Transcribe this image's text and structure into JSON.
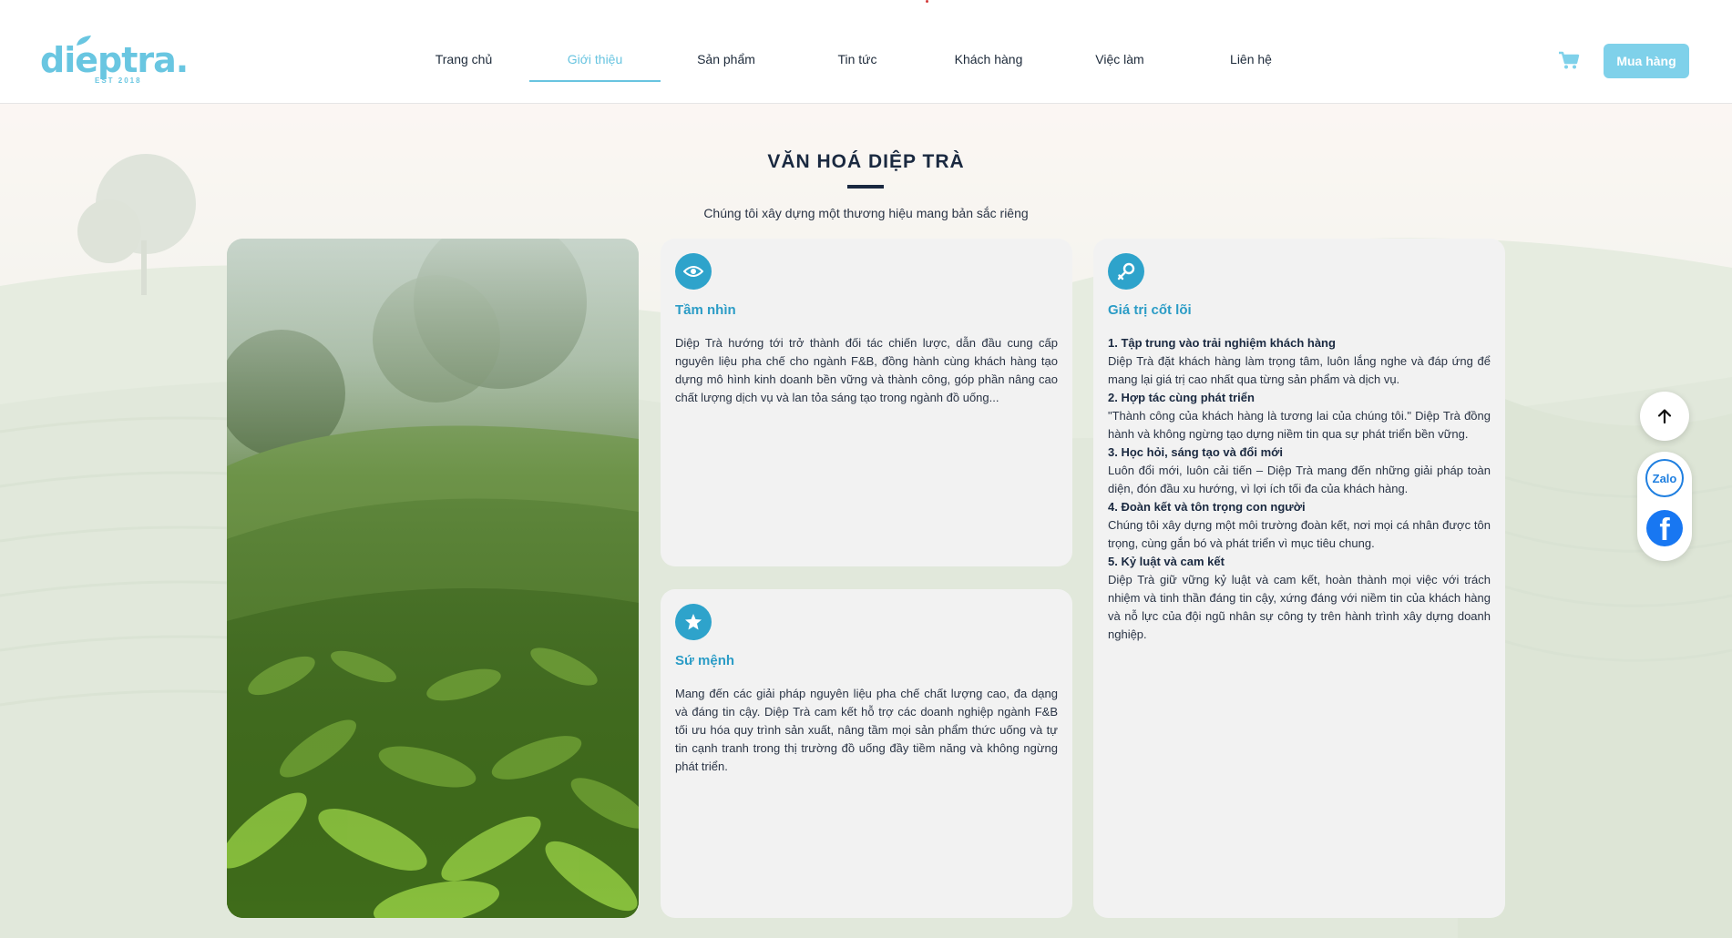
{
  "brand": {
    "logo_text": "dieptra.",
    "logo_sub": "EST 2018"
  },
  "nav": {
    "items": [
      {
        "label": "Trang chủ",
        "active": false
      },
      {
        "label": "Giới thiệu",
        "active": true
      },
      {
        "label": "Sản phẩm",
        "active": false
      },
      {
        "label": "Tin tức",
        "active": false
      },
      {
        "label": "Khách hàng",
        "active": false
      },
      {
        "label": "Việc làm",
        "active": false
      },
      {
        "label": "Liên hệ",
        "active": false
      }
    ],
    "buy_label": "Mua hàng",
    "accent_color": "#68c4e0"
  },
  "section": {
    "title": "VĂN HOÁ DIỆP TRÀ",
    "subtitle": "Chúng tôi xây dựng một thương hiệu mang bản sắc riêng"
  },
  "vision": {
    "icon": "eye-icon",
    "title": "Tầm nhìn",
    "text": "Diệp Trà hướng tới trở thành đối tác chiến lược, dẫn đầu cung cấp nguyên liệu pha chế cho ngành F&B, đồng hành cùng khách hàng tạo dựng mô hình kinh doanh bền vững và thành công, góp phần nâng cao chất lượng dịch vụ và lan tỏa sáng tạo trong ngành đồ uống..."
  },
  "mission": {
    "icon": "star-icon",
    "title": "Sứ mệnh",
    "text": "Mang đến các giải pháp nguyên liệu pha chế chất lượng cao, đa dạng và đáng tin cậy. Diệp Trà cam kết hỗ trợ các doanh nghiệp ngành F&B tối ưu hóa quy trình sản xuất, nâng tầm mọi sản phẩm thức uống và tự tin cạnh tranh trong thị trường đồ uống đầy tiềm năng và không ngừng phát triển."
  },
  "core_values": {
    "icon": "key-icon",
    "title": "Giá trị cốt lõi",
    "items": [
      {
        "head": "1. Tập trung vào trải nghiệm khách hàng",
        "body": "Diệp Trà đặt khách hàng làm trọng tâm, luôn lắng nghe và đáp ứng để mang lại giá trị cao nhất qua từng sản phẩm và dịch vụ."
      },
      {
        "head": "2. Hợp tác cùng phát triển",
        "body": "\"Thành công của khách hàng là tương lai của chúng tôi.\" Diệp Trà đồng hành và không ngừng tạo dựng niềm tin qua sự phát triển bền vững."
      },
      {
        "head": "3. Học hỏi, sáng tạo và đổi mới",
        "body": "Luôn đổi mới, luôn cải tiến – Diệp Trà mang đến những giải pháp toàn diện, đón đầu xu hướng, vì lợi ích tối đa của khách hàng."
      },
      {
        "head": "4. Đoàn kết và tôn trọng con người",
        "body": "Chúng tôi xây dựng một môi trường đoàn kết, nơi mọi cá nhân được tôn trọng, cùng gắn bó và phát triển vì mục tiêu chung."
      },
      {
        "head": "5. Kỷ luật và cam kết",
        "body": "Diệp Trà giữ vững kỷ luật và cam kết, hoàn thành mọi việc với trách nhiệm và tinh thần đáng tin cậy, xứng đáng với niềm tin của khách hàng và nỗ lực của đội ngũ nhân sự công ty trên hành trình xây dựng doanh nghiệp."
      }
    ]
  },
  "floating": {
    "zalo_label": "Zalo",
    "facebook_label": "f"
  }
}
